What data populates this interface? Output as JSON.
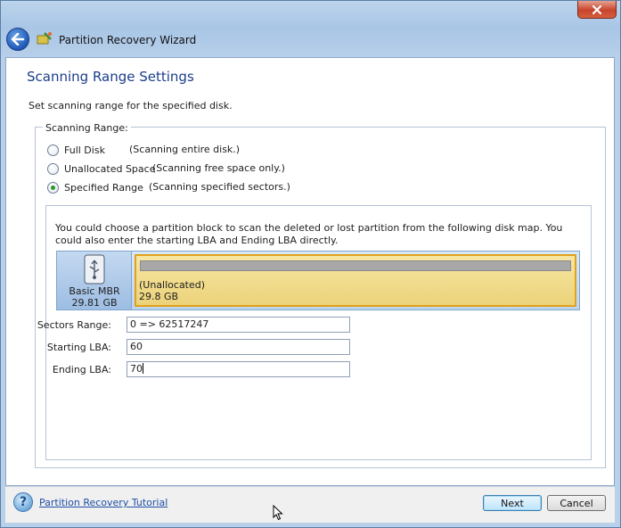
{
  "window": {
    "title": "Partition Recovery Wizard",
    "close_icon": "close-icon",
    "back_icon": "back-arrow-icon",
    "app_icon": "partition-wizard-icon"
  },
  "page": {
    "heading": "Scanning Range Settings",
    "subheading": "Set scanning range for the specified disk."
  },
  "scanning_range": {
    "legend": "Scanning Range:",
    "options": [
      {
        "label": "Full Disk",
        "desc": "(Scanning entire disk.)",
        "selected": false
      },
      {
        "label": "Unallocated Space",
        "desc": "(Scanning free space only.)",
        "selected": false
      },
      {
        "label": "Specified Range",
        "desc": "(Scanning specified sectors.)",
        "selected": true
      }
    ]
  },
  "specified": {
    "description": "You could choose a partition block to scan the deleted or lost partition from the following disk map. You could also enter the starting LBA and Ending LBA directly.",
    "disk": {
      "name": "Basic MBR",
      "size": "29.81 GB",
      "icon": "usb-drive-icon"
    },
    "partition": {
      "name": "(Unallocated)",
      "size": "29.8 GB"
    },
    "fields": {
      "sectors_range_label": "Sectors Range:",
      "sectors_range_value": "0 => 62517247",
      "starting_lba_label": "Starting LBA:",
      "starting_lba_value": "60",
      "ending_lba_label": "Ending LBA:",
      "ending_lba_value": "70"
    }
  },
  "footer": {
    "tutorial_link": "Partition Recovery Tutorial",
    "next_label": "Next",
    "cancel_label": "Cancel",
    "help_icon": "help-icon"
  }
}
